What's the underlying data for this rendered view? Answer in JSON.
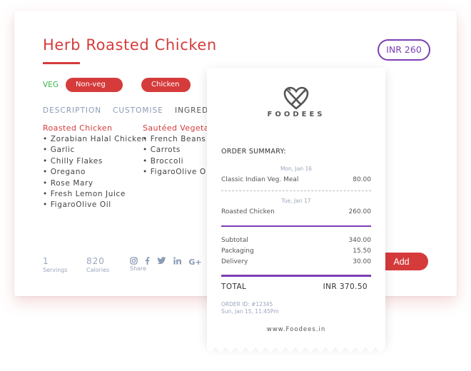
{
  "dish": {
    "title": "Herb Roasted Chicken",
    "price": "INR 260",
    "veg_label": "VEG",
    "tags": [
      "Non-veg",
      "Chicken"
    ]
  },
  "tabs": [
    "DESCRIPTION",
    "CUSTOMISE",
    "INGRED"
  ],
  "ingredients": {
    "col1": {
      "heading": "Roasted Chicken",
      "items": [
        "Zorabian Halal Chicken",
        "Garlic",
        "Chilly Flakes",
        "Oregano",
        "Rose Mary",
        "Fresh Lemon Juice",
        "FigaroOlive Oil"
      ]
    },
    "col2": {
      "heading": "Sautéed Vegeta",
      "items": [
        "French Beans",
        "Carrots",
        "Broccoli",
        "FigaroOlive O"
      ]
    }
  },
  "stats": {
    "servings_value": "1",
    "servings_label": "Servings",
    "calories_value": "820",
    "calories_label": "Calories",
    "share_label": "Share"
  },
  "add_button": "Add",
  "receipt": {
    "brand": "FOODEES",
    "heading": "ORDER SUMMARY:",
    "date1": "Mon, Jan 16",
    "item1_name": "Classic Indian Veg. Meal",
    "item1_amount": "80.00",
    "date2": "Tue, Jan 17",
    "item2_name": "Roasted Chicken",
    "item2_amount": "260.00",
    "subtotal_label": "Subtotal",
    "subtotal": "340.00",
    "packaging_label": "Packaging",
    "packaging": "15.50",
    "delivery_label": "Delivery",
    "delivery": "30.00",
    "total_label": "TOTAL",
    "total": "INR 370.50",
    "order_id": "ORDER ID: #12345",
    "order_time": "Sun, Jan 15, 11:45Pm",
    "website": "www.Foodees.in"
  },
  "colors": {
    "accent_red": "#d63b3b",
    "accent_purple": "#7b3fb5",
    "veg_green": "#3bb54a",
    "muted_blue": "#8b9bb5"
  }
}
